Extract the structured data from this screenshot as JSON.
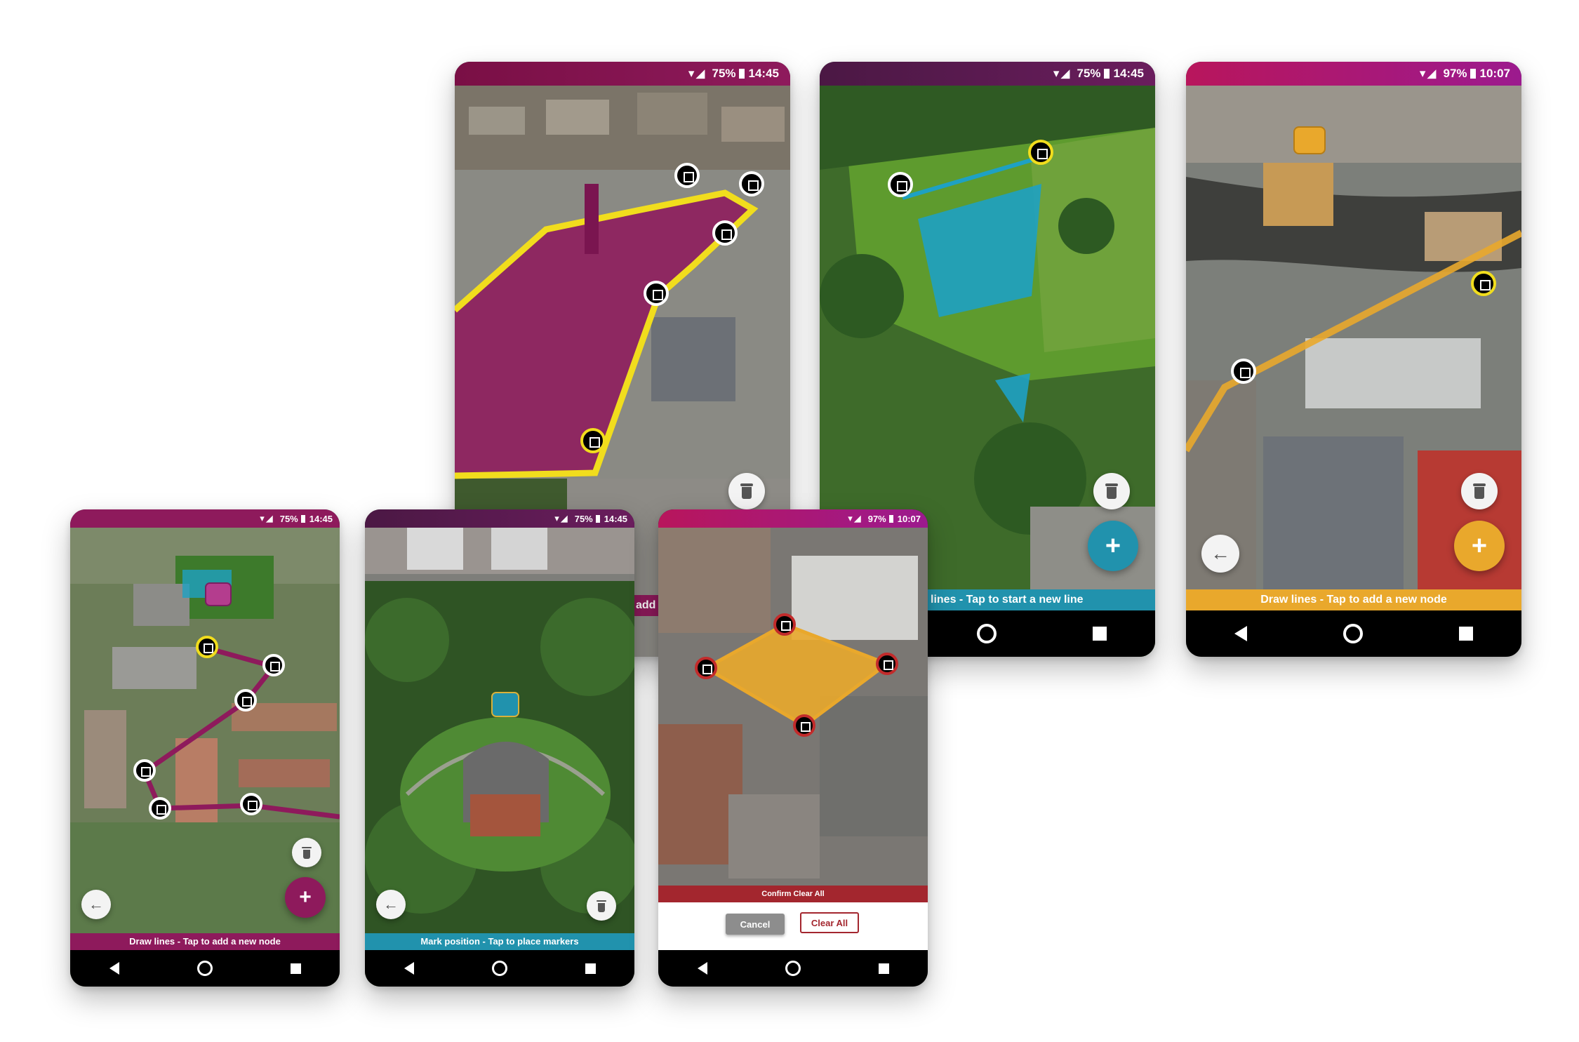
{
  "screens": {
    "s1": {
      "status": {
        "battery": "75%",
        "time": "14:45"
      },
      "mode_label": "add"
    },
    "s2": {
      "status": {
        "battery": "75%",
        "time": "14:45"
      },
      "mode_label": "lines - Tap to start a new line",
      "fab_label": "+"
    },
    "s3": {
      "status": {
        "battery": "97%",
        "time": "10:07"
      },
      "mode_label": "Draw lines - Tap to add a new node",
      "fab_label": "+",
      "back_label": "←"
    },
    "s4": {
      "status": {
        "battery": "75%",
        "time": "14:45"
      },
      "mode_label": "Draw lines - Tap to add a new node",
      "fab_label": "+",
      "back_label": "←"
    },
    "s5": {
      "status": {
        "battery": "75%",
        "time": "14:45"
      },
      "mode_label": "Mark position - Tap to place markers",
      "back_label": "←"
    },
    "s6": {
      "status": {
        "battery": "97%",
        "time": "10:07"
      },
      "dialog_title": "Confirm Clear All",
      "cancel_label": "Cancel",
      "clear_label": "Clear All"
    }
  },
  "colors": {
    "magenta": "#8e1a5c",
    "teal": "#2192ad",
    "amber": "#e9a82c",
    "confirm_red": "#a3262e"
  },
  "icons": [
    "wifi-icon",
    "signal-icon",
    "battery-icon",
    "trash-icon",
    "plus-icon",
    "back-arrow-icon",
    "nav-back-icon",
    "nav-home-icon",
    "nav-recent-icon",
    "node-marker-icon",
    "pin-marker-icon"
  ]
}
